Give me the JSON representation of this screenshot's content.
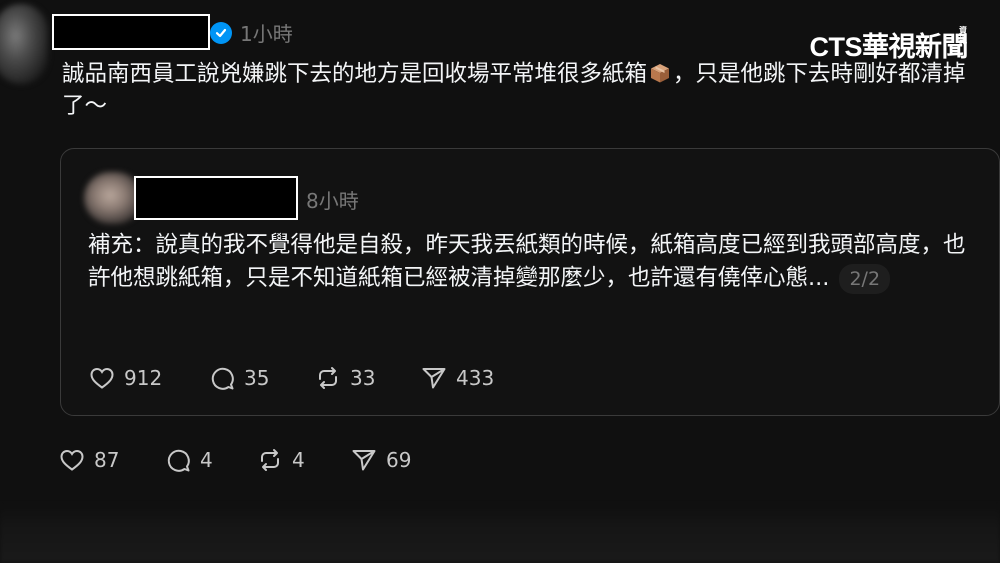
{
  "post": {
    "time": "1小時",
    "text": "誠品南西員工說兇嫌跳下去的地方是回收場平常堆很多紙箱",
    "text_after_emoji": "，只是他跳下去時剛好都清掉了～",
    "likes": "87",
    "replies": "4",
    "reposts": "4",
    "shares": "69"
  },
  "quoted": {
    "time": "8小時",
    "text": "補充：說真的我不覺得他是自殺，昨天我丟紙類的時候，紙箱高度已經到我頭部高度，也許他想跳紙箱，只是不知道紙箱已經被清掉變那麼少，也許還有僥倖心態...",
    "page_indicator": "2/2",
    "likes": "912",
    "replies": "35",
    "reposts": "33",
    "shares": "433"
  },
  "brand": {
    "logo": "CTS華視新聞",
    "small": "資訊"
  },
  "icons": {
    "verified": "verified-badge-icon",
    "emoji": "package-box-emoji",
    "like": "heart-icon",
    "reply": "comment-bubble-icon",
    "repost": "repost-icon",
    "share": "send-icon"
  },
  "colors": {
    "background": "#101010",
    "text": "#f3f5f7",
    "muted": "#777777",
    "verified": "#0095f6"
  }
}
